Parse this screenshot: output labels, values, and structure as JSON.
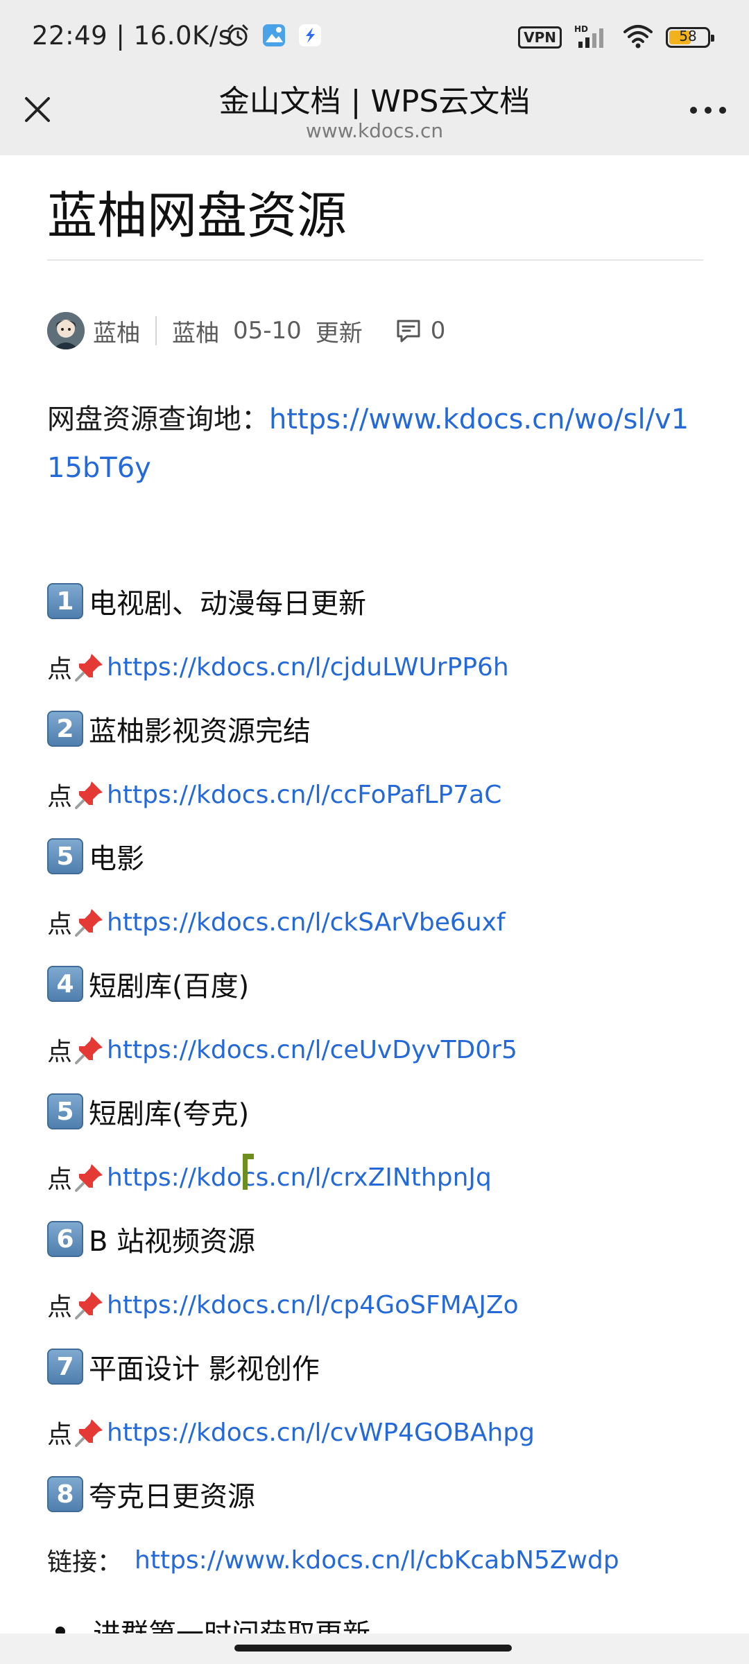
{
  "status_bar": {
    "time": "22:49 | 16.0K/s",
    "vpn": "VPN",
    "battery": "58",
    "battery_level": 0.58,
    "icons": [
      "alarm-icon",
      "gallery-app-icon",
      "app-notification-icon",
      "vpn-icon",
      "hd-signal-icon",
      "wifi-icon",
      "battery-icon"
    ]
  },
  "titlebar": {
    "title": "金山文档 | WPS云文档",
    "subtitle": "www.kdocs.cn",
    "close_icon": "close-icon",
    "more_icon": "more-icon"
  },
  "doc": {
    "title": "蓝柚网盘资源",
    "author": "蓝柚",
    "updated_by": "蓝柚",
    "updated_date": "05-10",
    "updated_label": "更新",
    "comment_count": "0",
    "query_label": "网盘资源查询地：",
    "query_link": "https://www.kdocs.cn/wo/sl/v115bT6y",
    "sections": [
      {
        "num": "1",
        "title": "电视剧、动漫每日更新",
        "prefix": "点",
        "link": "https://kdocs.cn/l/cjduLWUrPP6h"
      },
      {
        "num": "2",
        "title": "蓝柚影视资源完结",
        "prefix": "点",
        "link": "https://kdocs.cn/l/ccFoPafLP7aC"
      },
      {
        "num": "5",
        "title": "电影",
        "prefix": "点",
        "link": "https://kdocs.cn/l/ckSArVbe6uxf"
      },
      {
        "num": "4",
        "title": "短剧库(百度)",
        "prefix": "点",
        "link": "https://kdocs.cn/l/ceUvDyvTD0r5"
      },
      {
        "num": "5",
        "title": "短剧库(夸克)",
        "prefix": "点",
        "link": "https://kdocs.cn/l/crxZINthpnJq"
      },
      {
        "num": "6",
        "title": "B 站视频资源",
        "prefix": "点",
        "link": "https://kdocs.cn/l/cp4GoSFMAJZo"
      },
      {
        "num": "7",
        "title": "平面设计 影视创作",
        "prefix": "点",
        "link": "https://kdocs.cn/l/cvWP4GOBAhpg"
      },
      {
        "num": "8",
        "title": "夸克日更资源",
        "prefix": "链接：",
        "link": "https://www.kdocs.cn/l/cbKcabN5Zwdp"
      }
    ],
    "bullet_text": "进群第一时间获取更新"
  }
}
